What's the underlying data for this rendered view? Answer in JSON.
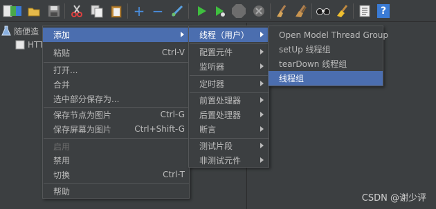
{
  "toolbar": {
    "icons": [
      "new-file-icon",
      "templates-icon",
      "open-icon",
      "save-icon",
      "cut-icon",
      "copy-icon",
      "paste-icon",
      "expand-icon",
      "collapse-icon",
      "toggle-icon",
      "start-icon",
      "start-no-pauses-icon",
      "stop-icon",
      "shutdown-icon",
      "clear-icon",
      "clear-all-icon",
      "search-icon",
      "reset-search-icon",
      "function-helper-icon",
      "help-icon"
    ],
    "help_glyph": "?"
  },
  "tree": {
    "root_label": "随便造",
    "child_label": "HTT"
  },
  "context_menu": {
    "items": [
      {
        "label": "添加",
        "submenu": true,
        "active": true
      },
      {
        "label": "粘贴",
        "shortcut": "Ctrl-V"
      },
      {
        "label": "打开..."
      },
      {
        "label": "合并"
      },
      {
        "label": "选中部分保存为..."
      },
      {
        "label": "保存节点为图片",
        "shortcut": "Ctrl-G"
      },
      {
        "label": "保存屏幕为图片",
        "shortcut": "Ctrl+Shift-G"
      },
      {
        "label": "启用",
        "disabled": true
      },
      {
        "label": "禁用"
      },
      {
        "label": "切换",
        "shortcut": "Ctrl-T"
      },
      {
        "label": "帮助"
      }
    ]
  },
  "add_menu": {
    "items": [
      {
        "label": "线程（用户）",
        "active": true
      },
      {
        "label": "配置元件"
      },
      {
        "label": "监听器"
      },
      {
        "label": "定时器"
      },
      {
        "label": "前置处理器"
      },
      {
        "label": "后置处理器"
      },
      {
        "label": "断言"
      },
      {
        "label": "测试片段"
      },
      {
        "label": "非测试元件"
      }
    ]
  },
  "threads_menu": {
    "items": [
      {
        "label": "Open Model Thread Group"
      },
      {
        "label": "setUp 线程组"
      },
      {
        "label": "tearDown 线程组"
      },
      {
        "label": "线程组",
        "active": true
      }
    ]
  },
  "watermark": "CSDN @谢少评",
  "colors": {
    "background": "#3c3f41",
    "menu_highlight": "#4b6eaf",
    "text": "#bbbbbb",
    "disabled_text": "#6d6d6d"
  }
}
